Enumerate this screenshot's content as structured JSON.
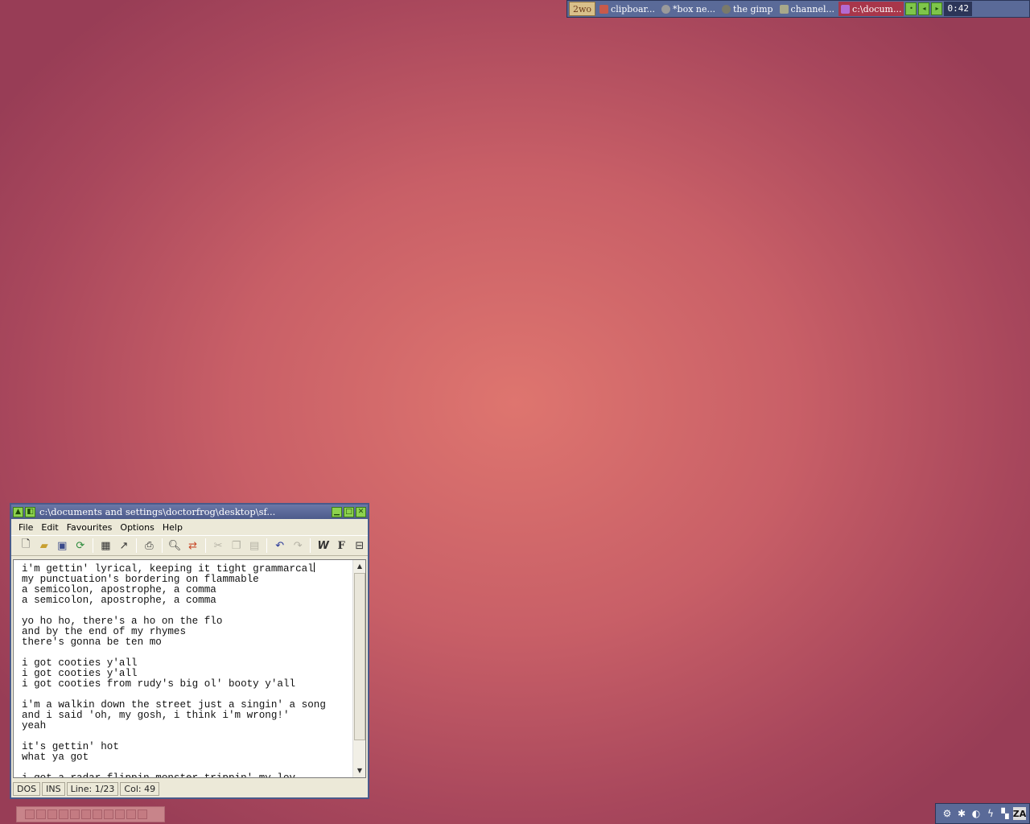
{
  "taskbar": {
    "desktop_label": "2wo",
    "tasks": [
      {
        "label": "clipboar...",
        "icon": "clipboard-icon",
        "active": false
      },
      {
        "label": "*box ne...",
        "icon": "gimp-image-icon",
        "active": false
      },
      {
        "label": "the gimp",
        "icon": "gimp-icon",
        "active": false
      },
      {
        "label": "channel...",
        "icon": "channel-icon",
        "active": false
      },
      {
        "label": "c:\\docum...",
        "icon": "editor-icon",
        "active": true
      }
    ],
    "clock": "0:42"
  },
  "window": {
    "title": "c:\\documents and settings\\doctorfrog\\desktop\\sf...",
    "menu": [
      "File",
      "Edit",
      "Favourites",
      "Options",
      "Help"
    ],
    "text_lines": [
      "i'm gettin' lyrical, keeping it tight grammarcal",
      "my punctuation's bordering on flammable",
      "a semicolon, apostrophe, a comma",
      "a semicolon, apostrophe, a comma",
      "",
      "yo ho ho, there's a ho on the flo",
      "and by the end of my rhymes",
      "there's gonna be ten mo",
      "",
      "i got cooties y'all",
      "i got cooties y'all",
      "i got cooties from rudy's big ol' booty y'all",
      "",
      "i'm a walkin down the street just a singin' a song",
      "and i said 'oh, my gosh, i think i'm wrong!'",
      "yeah",
      "",
      "it's gettin' hot",
      "what ya got",
      "",
      "i got a radar flippin monster trippin' my lov"
    ],
    "status": {
      "format": "DOS",
      "mode": "INS",
      "line": "Line: 1/23",
      "col": "Col: 49"
    }
  }
}
